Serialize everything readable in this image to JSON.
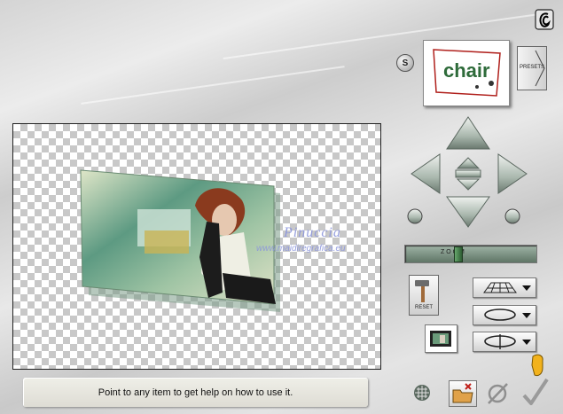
{
  "help": {
    "text": "Point to any item to get help on how to use it."
  },
  "preset": {
    "thumb_text": "chair",
    "label": "PRESETS"
  },
  "sync_button": {
    "label": "S"
  },
  "zoom": {
    "label": "Z O O M",
    "level": 0.4
  },
  "reset": {
    "label": "RESET"
  },
  "watermark": {
    "name": "Pinuccia",
    "site": "www.maidiregrafica.eu"
  },
  "colors": {
    "accent": "#8f9d92",
    "frame": "#222222",
    "slider": "#6e8674"
  },
  "icons": [
    "corel-logo-icon",
    "arrow-up-icon",
    "arrow-down-icon",
    "arrow-left-icon",
    "arrow-right-icon",
    "rotate-left-icon",
    "rotate-right-icon",
    "reset-hammer-icon",
    "perspective-grid-icon",
    "rotate-ring-icon",
    "flip-icon",
    "image-thumbnail-icon",
    "grid-toggle-icon",
    "open-folder-icon",
    "cancel-icon",
    "ok-check-icon",
    "pointing-hand-icon"
  ]
}
